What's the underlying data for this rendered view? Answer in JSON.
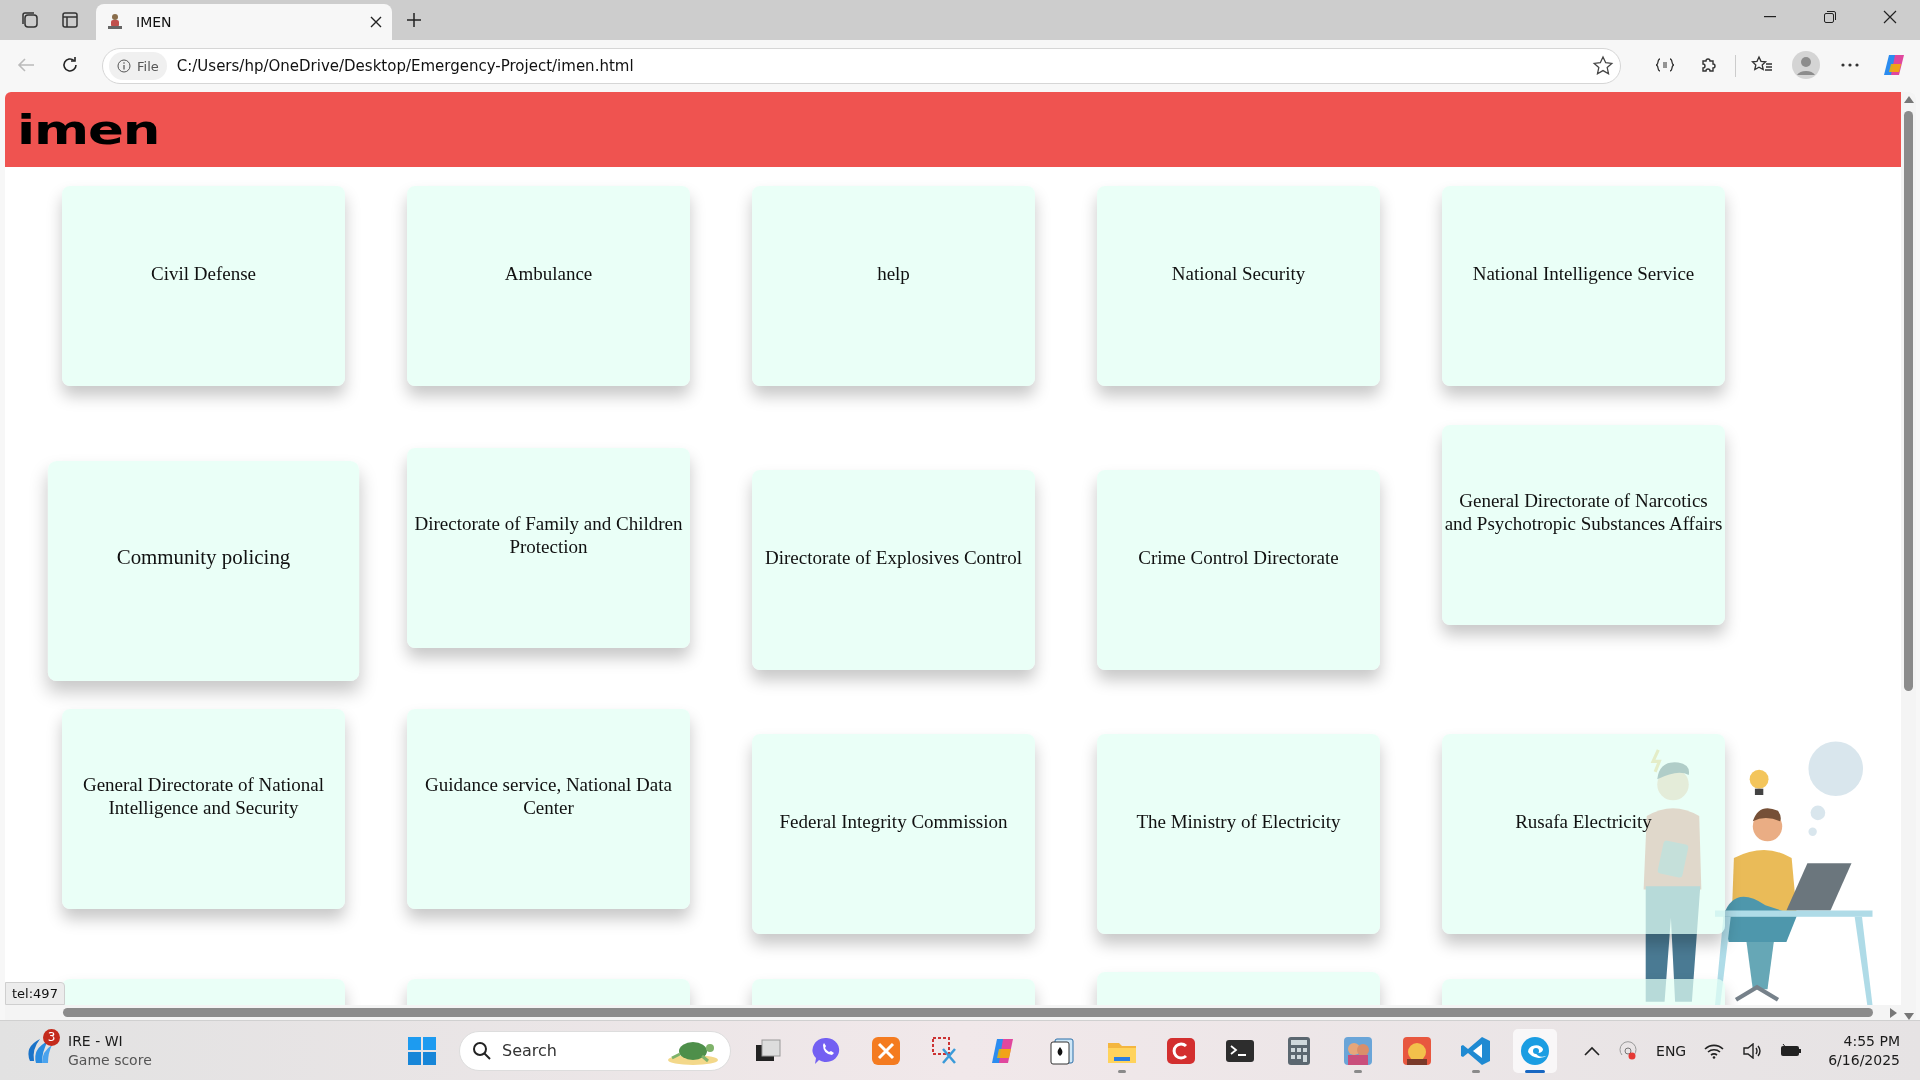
{
  "browser": {
    "tab": {
      "title": "IMEN",
      "selected": true
    },
    "address": {
      "scheme": "File",
      "url": "C:/Users/hp/OneDrive/Desktop/Emergency-Project/imen.html"
    }
  },
  "page": {
    "logo": "imen",
    "cards": [
      {
        "label": "Civil Defense",
        "hovered": false
      },
      {
        "label": "Ambulance",
        "hovered": false
      },
      {
        "label": "help",
        "hovered": false
      },
      {
        "label": "National Security",
        "hovered": false
      },
      {
        "label": "National Intelligence Service",
        "hovered": false
      },
      {
        "label": "Community policing",
        "hovered": true
      },
      {
        "label": "Directorate of Family and Children Protection",
        "hovered": false
      },
      {
        "label": "Directorate of Explosives Control",
        "hovered": false
      },
      {
        "label": "Crime Control Directorate",
        "hovered": false
      },
      {
        "label": "General Directorate of Narcotics and Psychotropic Substances Affairs",
        "hovered": false
      },
      {
        "label": "General Directorate of National Intelligence and Security",
        "hovered": false
      },
      {
        "label": "Guidance service, National Data Center",
        "hovered": false
      },
      {
        "label": "Federal Integrity Commission",
        "hovered": false
      },
      {
        "label": "The Ministry of Electricity",
        "hovered": false
      },
      {
        "label": "Rusafa Electricity",
        "hovered": false
      },
      {
        "hovered": false
      },
      {
        "hovered": false
      },
      {
        "hovered": false
      },
      {
        "hovered": false
      },
      {
        "hovered": false
      }
    ],
    "status_link": "tel:497"
  },
  "taskbar": {
    "widget": {
      "title": "IRE - WI",
      "subtitle": "Game score",
      "badge": "3"
    },
    "search": {
      "placeholder": "Search"
    },
    "apps": [
      {
        "kind": "taskview",
        "running": false,
        "active": false
      },
      {
        "kind": "viber",
        "running": false,
        "active": false
      },
      {
        "kind": "xampp",
        "running": false,
        "active": false
      },
      {
        "kind": "snip",
        "running": false,
        "active": false
      },
      {
        "kind": "copilot",
        "running": false,
        "active": false
      },
      {
        "kind": "solitaire",
        "running": false,
        "active": false
      },
      {
        "kind": "files",
        "running": true,
        "active": false
      },
      {
        "kind": "cinema",
        "running": false,
        "active": false
      },
      {
        "kind": "terminal",
        "running": false,
        "active": false
      },
      {
        "kind": "calculator",
        "running": false,
        "active": false
      },
      {
        "kind": "game",
        "running": true,
        "active": false
      },
      {
        "kind": "arcade",
        "running": false,
        "active": false
      },
      {
        "kind": "code",
        "running": true,
        "active": false
      },
      {
        "kind": "edge",
        "running": true,
        "active": true
      }
    ],
    "language": "ENG",
    "time": "4:55 PM",
    "date": "6/16/2025"
  }
}
